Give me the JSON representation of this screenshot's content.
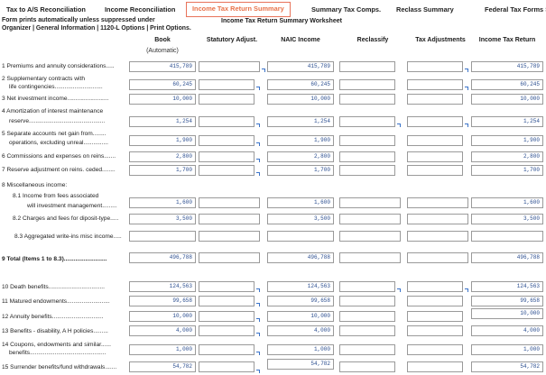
{
  "tabs": [
    {
      "label": "Tax to A/S Reconciliation",
      "active": false
    },
    {
      "label": "Income Reconciliation",
      "active": false
    },
    {
      "label": "Income Tax Return Summary",
      "active": true
    },
    {
      "label": "Summary Tax Comps.",
      "active": false
    },
    {
      "label": "Reclass Summary",
      "active": false
    },
    {
      "label": "Federal Tax Forms Summar",
      "active": false
    }
  ],
  "header": {
    "note_line1": "Form prints automatically unless suppressed under",
    "note_line2": "Organizer | General Information | 1120-L Options | Print Options.",
    "worksheet_title": "Income Tax Return Summary Worksheet"
  },
  "columns": {
    "book": "Book",
    "book_sub": "(Automatic)",
    "statutory": "Statutory Adjust.",
    "naic": "NAIC Income",
    "reclassify": "Reclassify",
    "tax_adj": "Tax Adjustments",
    "itr": "Income Tax Return"
  },
  "colors": {
    "active_tab": "#e8734a",
    "value_text": "#2a4d8f",
    "cell_border": "#9a9a9a",
    "arrow": "#3a73c9"
  },
  "rows": {
    "r1": {
      "label": "1 Premiums and annuity considerations.....",
      "book": "415,789",
      "naic": "415,789",
      "itr": "415,789"
    },
    "r2": {
      "label1": "2 Supplementary contracts with",
      "label2": "life contingencies.............................",
      "book": "60,245",
      "naic": "60,245",
      "itr": "60,245"
    },
    "r3": {
      "label": "3 Net investment income.........................",
      "book": "10,000",
      "naic": "10,000",
      "itr": "10,000"
    },
    "r4": {
      "label1": "4 Amortization of interest maintenance",
      "label2": "reserve..............................................",
      "book": "1,254",
      "naic": "1,254",
      "itr": "1,254"
    },
    "r5": {
      "label1": "5 Separate accounts net gain from........",
      "label2": "operations, excluding unreal...............",
      "book": "1,900",
      "naic": "1,900",
      "itr": "1,900"
    },
    "r6": {
      "label": "6 Commissions and expenses on reins.......",
      "book": "2,800",
      "naic": "2,800",
      "itr": "2,800"
    },
    "r7": {
      "label": "7 Reserve adjustment on reins. ceded........",
      "book": "1,700",
      "naic": "1,700",
      "itr": "1,700"
    },
    "r8": {
      "label": "8 Miscellaneous income:"
    },
    "r81": {
      "label1": "8.1 Income from fees associated",
      "label2": "will investment management.........",
      "book": "1,600",
      "naic": "1,600",
      "itr": "1,600"
    },
    "r82": {
      "label": "8.2 Charges and fees for diposit-type.....",
      "book": "3,500",
      "naic": "3,500",
      "itr": "3,500"
    },
    "r83": {
      "label": "8.3 Aggregated write-ins misc income....."
    },
    "r9": {
      "label": "9  Total (Items 1 to 8.3)..........................",
      "book": "496,788",
      "naic": "496,788",
      "itr": "496,788"
    },
    "r10": {
      "label": "10 Death benefits..................................",
      "book": "124,563",
      "naic": "124,563",
      "itr": "124,563"
    },
    "r11": {
      "label": "11 Matured endowments..........................",
      "book": "99,658",
      "naic": "99,658",
      "itr": "99,658"
    },
    "r12": {
      "label": "12 Annuity benefits...............................",
      "book": "10,000",
      "naic": "10,000",
      "itr": "10,000"
    },
    "r13": {
      "label": "13 Benefits - disability, A H policies.........",
      "book": "4,000",
      "naic": "4,000",
      "itr": "4,000"
    },
    "r14": {
      "label1": "14 Coupons, endowments and similar......",
      "label2": "benefits..............................................",
      "book": "1,000",
      "naic": "1,000",
      "itr": "1,000"
    },
    "r15": {
      "label": "15 Surrender benefits/fund withdrawals.......",
      "book": "54,782",
      "naic": "54,782",
      "itr": "54,782"
    }
  }
}
